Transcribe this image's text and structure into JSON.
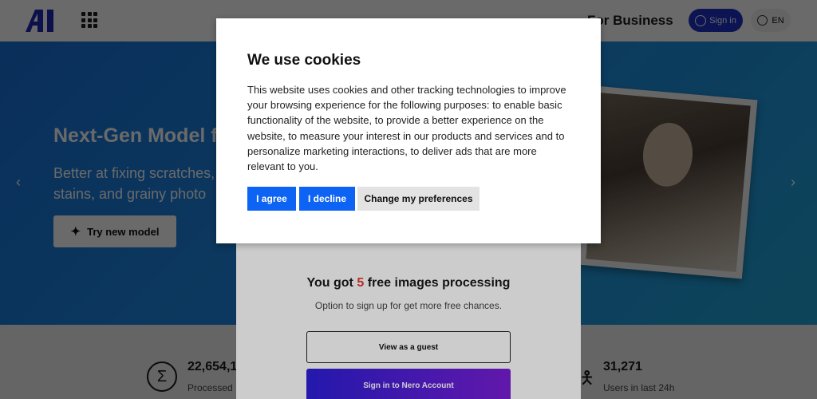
{
  "header": {
    "logo_text": "AI",
    "business_link": "For Business",
    "signin_label": "Sign in",
    "lang_label": "EN"
  },
  "hero": {
    "title": "Next-Gen Model f",
    "subtitle": "Better at fixing scratches, stains, and grainy photo",
    "cta_label": "Try new model",
    "arrow_left": "‹",
    "arrow_right": "›"
  },
  "stats": {
    "left_value": "22,654,1",
    "left_label": "Processed",
    "right_value": "31,271",
    "right_label": "Users in last 24h"
  },
  "free_modal": {
    "title_prefix": "You got",
    "count": "5",
    "title_suffix": "free images processing",
    "subtitle": "Option to sign up for get more free chances.",
    "guest_button": "View as a guest",
    "nero_button": "Sign in to Nero Account"
  },
  "cookie": {
    "title": "We use cookies",
    "body": "This website uses cookies and other tracking technologies to improve your browsing experience for the following purposes: to enable basic functionality of the website, to provide a better experience on the website, to measure your interest in our products and services and to personalize marketing interactions, to deliver ads that are more relevant to you.",
    "agree_label": "I agree",
    "decline_label": "I decline",
    "prefs_label": "Change my preferences"
  },
  "colors": {
    "primary_button": "#0d63f3",
    "hero_blue": "#1e88e5",
    "highlight_red": "#e53935"
  }
}
